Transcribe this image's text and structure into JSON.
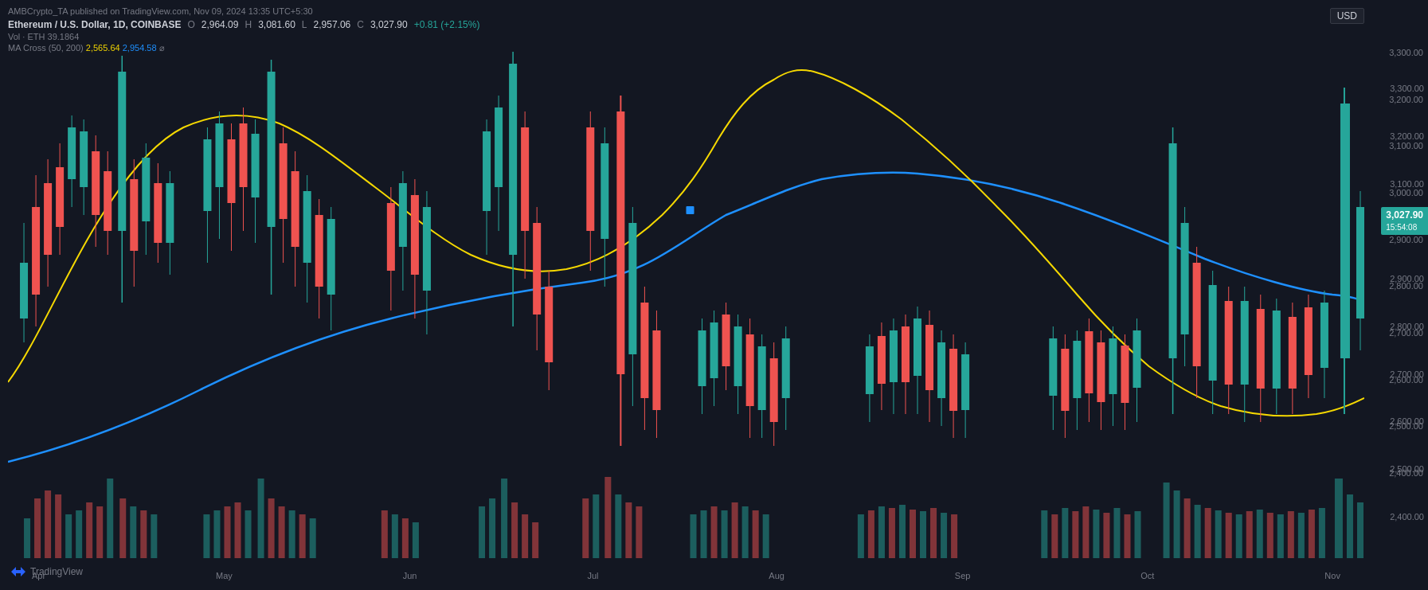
{
  "publish_info": "AMBCrypto_TA published on TradingView.com, Nov 09, 2024 13:35 UTC+5:30",
  "symbol": {
    "name": "Ethereum / U.S. Dollar, 1D, COINBASE",
    "short": "ETH",
    "open_label": "O",
    "open_val": "2,964.09",
    "high_label": "H",
    "high_val": "3,081.60",
    "low_label": "L",
    "low_val": "2,957.06",
    "close_label": "C",
    "close_val": "3,027.90",
    "change_val": "+0.81",
    "change_pct": "+2.15%"
  },
  "vol_info": "Vol · ETH  39.1864",
  "ma_info": {
    "label": "MA Cross (50, 200)",
    "val1": "2,565.64",
    "val2": "2,954.58"
  },
  "usd_label": "USD",
  "price_badge": {
    "price": "3,027.90",
    "time": "15:54:08"
  },
  "price_ticks": [
    "3,300.00",
    "3,200.00",
    "3,100.00",
    "3,000.00",
    "2,900.00",
    "2,800.00",
    "2,700.00",
    "2,600.00",
    "2,500.00",
    "2,400.00"
  ],
  "time_labels": [
    "Apr",
    "May",
    "Jun",
    "Jul",
    "Aug",
    "Sep",
    "Oct",
    "Nov"
  ],
  "tradingview_label": "TradingView",
  "colors": {
    "background": "#131722",
    "grid": "rgba(255,255,255,0.06)",
    "bullish": "#26a69a",
    "bearish": "#ef5350",
    "ma50": "#f5d800",
    "ma200": "#1e90ff",
    "text_muted": "#787b86",
    "text_main": "#d1d4dc"
  }
}
